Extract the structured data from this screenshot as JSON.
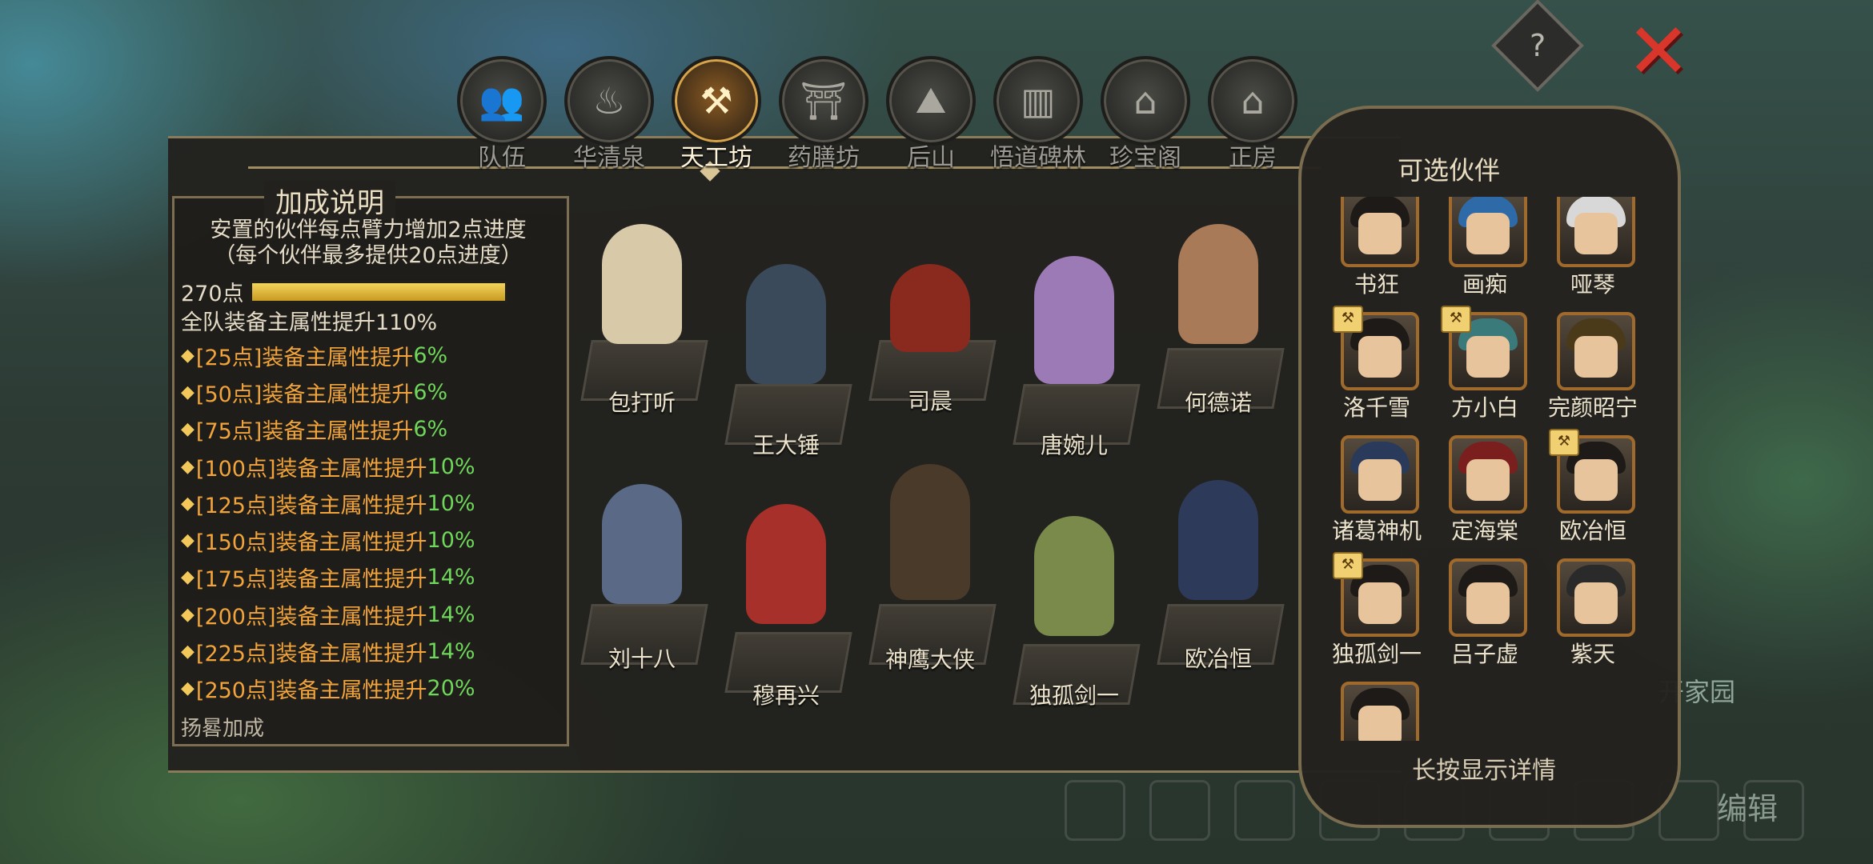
{
  "nav": {
    "tabs": [
      {
        "label": "队伍",
        "icon": "team-icon"
      },
      {
        "label": "华清泉",
        "icon": "spring-icon"
      },
      {
        "label": "天工坊",
        "icon": "workshop-icon",
        "active": true
      },
      {
        "label": "药膳坊",
        "icon": "kitchen-icon"
      },
      {
        "label": "后山",
        "icon": "mountain-icon"
      },
      {
        "label": "悟道碑林",
        "icon": "stele-icon"
      },
      {
        "label": "珍宝阁",
        "icon": "treasure-icon"
      },
      {
        "label": "正房",
        "icon": "house-icon"
      }
    ],
    "help_glyph": "?",
    "close_glyph": "✕"
  },
  "bonus": {
    "title": "加成说明",
    "desc_line1": "安置的伙伴每点臂力增加2点进度",
    "desc_line2": "（每个伙伴最多提供20点进度）",
    "points": "270点",
    "progress_fraction": 1.0,
    "team_line": "全队装备主属性提升110%",
    "tiers": [
      {
        "tier": "[25点]装备主属性提升",
        "value": "6%"
      },
      {
        "tier": "[50点]装备主属性提升",
        "value": "6%"
      },
      {
        "tier": "[75点]装备主属性提升",
        "value": "6%"
      },
      {
        "tier": "[100点]装备主属性提升",
        "value": "10%"
      },
      {
        "tier": "[125点]装备主属性提升",
        "value": "10%"
      },
      {
        "tier": "[150点]装备主属性提升",
        "value": "10%"
      },
      {
        "tier": "[175点]装备主属性提升",
        "value": "14%"
      },
      {
        "tier": "[200点]装备主属性提升",
        "value": "14%"
      },
      {
        "tier": "[225点]装备主属性提升",
        "value": "14%"
      },
      {
        "tier": "[250点]装备主属性提升",
        "value": "20%"
      }
    ],
    "overflow_label": "扬晷加成"
  },
  "workshop": {
    "slots": [
      {
        "name": "包打听"
      },
      {
        "name": "王大锤"
      },
      {
        "name": "司晨"
      },
      {
        "name": "唐婉儿"
      },
      {
        "name": "何德诺"
      },
      {
        "name": "刘十八"
      },
      {
        "name": "穆再兴"
      },
      {
        "name": "神鹰大侠"
      },
      {
        "name": "独孤剑一"
      },
      {
        "name": "欧冶恒"
      }
    ]
  },
  "partners": {
    "title": "可选伙伴",
    "items": [
      {
        "name": "书狂",
        "badge": true
      },
      {
        "name": "画痴",
        "badge": true
      },
      {
        "name": "哑琴",
        "badge": true
      },
      {
        "name": "洛千雪",
        "badge": true
      },
      {
        "name": "方小白",
        "badge": true
      },
      {
        "name": "完颜昭宁",
        "badge": false
      },
      {
        "name": "诸葛神机",
        "badge": false
      },
      {
        "name": "定海棠",
        "badge": false
      },
      {
        "name": "欧冶恒",
        "badge": true
      },
      {
        "name": "独孤剑一",
        "badge": true
      },
      {
        "name": "吕子虚",
        "badge": false
      },
      {
        "name": "紫天",
        "badge": false
      },
      {
        "name": "",
        "badge": false
      }
    ],
    "hint": "长按显示详情"
  },
  "background": {
    "home_label": "开家园",
    "edit_label": "编辑"
  },
  "colors": {
    "tier_text": "#f2a43a",
    "tier_value": "#6fd85a",
    "progress_fill": "#e5bf3c",
    "portrait_border": "#a06a2c",
    "close": "#d9362b"
  }
}
